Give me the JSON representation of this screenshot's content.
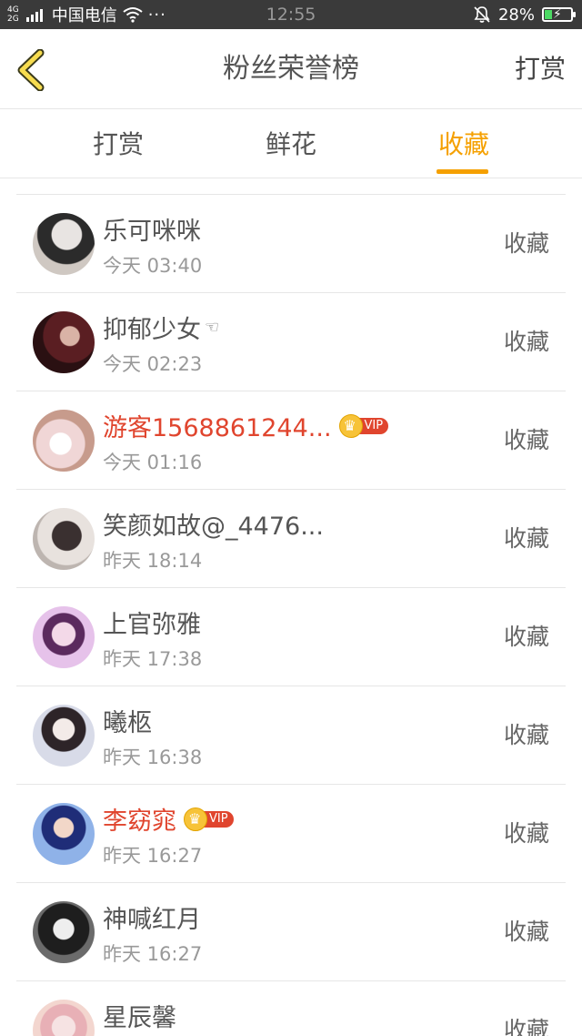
{
  "status_bar": {
    "network_top": "4G",
    "network_bottom": "2G",
    "carrier": "中国电信",
    "more": "···",
    "time": "12:55",
    "battery_percent": "28%",
    "battery_level": 0.28
  },
  "nav": {
    "title": "粉丝荣誉榜",
    "action": "打赏"
  },
  "tabs": [
    {
      "label": "打赏",
      "active": false
    },
    {
      "label": "鲜花",
      "active": false
    },
    {
      "label": "收藏",
      "active": true
    }
  ],
  "vip_label": "VIP",
  "colors": {
    "accent": "#f5a000",
    "vip_name": "#e0452e",
    "status_bar_bg": "#3a3a3a"
  },
  "list": [
    {
      "name": "乐可咪咪",
      "time": "今天 03:40",
      "action": "收藏",
      "vip": false
    },
    {
      "name": "抑郁少女",
      "suffix_icon": "pointing-hand-icon",
      "time": "今天 02:23",
      "action": "收藏",
      "vip": false
    },
    {
      "name": "游客1568861244...",
      "time": "今天 01:16",
      "action": "收藏",
      "vip": true
    },
    {
      "name": "笑颜如故@_4476...",
      "time": "昨天 18:14",
      "action": "收藏",
      "vip": false
    },
    {
      "name": "上官弥雅",
      "time": "昨天 17:38",
      "action": "收藏",
      "vip": false
    },
    {
      "name": "曦柩",
      "time": "昨天 16:38",
      "action": "收藏",
      "vip": false
    },
    {
      "name": "李窈窕",
      "time": "昨天 16:27",
      "action": "收藏",
      "vip": true
    },
    {
      "name": "神喊红月",
      "time": "昨天 16:27",
      "action": "收藏",
      "vip": false
    },
    {
      "name": "星辰馨",
      "time": "",
      "action": "收藏",
      "vip": false
    }
  ]
}
